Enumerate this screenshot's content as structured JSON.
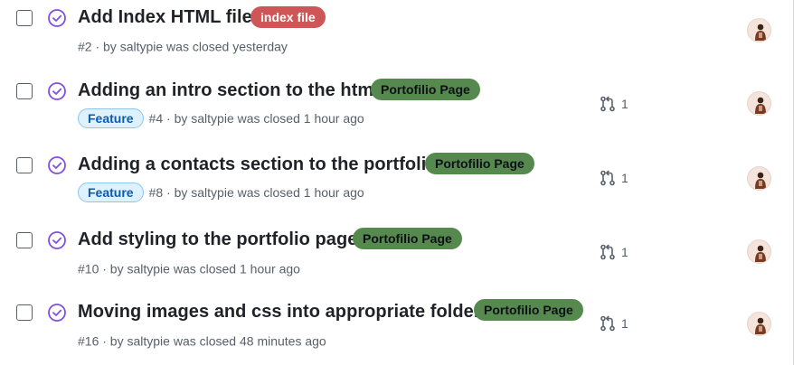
{
  "issues": [
    {
      "title": "Add Index HTML file",
      "label": "index file",
      "label_color": "#cf5656",
      "feature": "",
      "meta": "#2 · by saltypie was closed yesterday",
      "pr_count": "",
      "status_icon": "issue-closed-icon",
      "avatar": "user-avatar"
    },
    {
      "title": "Adding an intro section to the html",
      "label": "Portofilio Page",
      "label_color": "#56894e",
      "feature": "Feature",
      "meta": "#4 · by saltypie was closed 1 hour ago",
      "pr_count": "1",
      "status_icon": "issue-closed-icon",
      "avatar": "user-avatar"
    },
    {
      "title": "Adding a contacts section to the portfolio",
      "label": "Portofilio Page",
      "label_color": "#56894e",
      "feature": "Feature",
      "meta": "#8 · by saltypie was closed 1 hour ago",
      "pr_count": "1",
      "status_icon": "issue-closed-icon",
      "avatar": "user-avatar"
    },
    {
      "title": "Add styling to the portfolio page",
      "label": "Portofilio Page",
      "label_color": "#56894e",
      "feature": "",
      "meta": "#10 · by saltypie was closed 1 hour ago",
      "pr_count": "1",
      "status_icon": "issue-closed-icon",
      "avatar": "user-avatar"
    },
    {
      "title": "Moving images and css into appropriate folders",
      "label": "Portofilio Page",
      "label_color": "#56894e",
      "feature": "",
      "meta": "#16 · by saltypie was closed 48 minutes ago",
      "pr_count": "1",
      "status_icon": "issue-closed-icon",
      "avatar": "user-avatar"
    }
  ],
  "icons": {
    "closed_issue_color": "#8250df",
    "pull_request": "pull-request-icon"
  }
}
